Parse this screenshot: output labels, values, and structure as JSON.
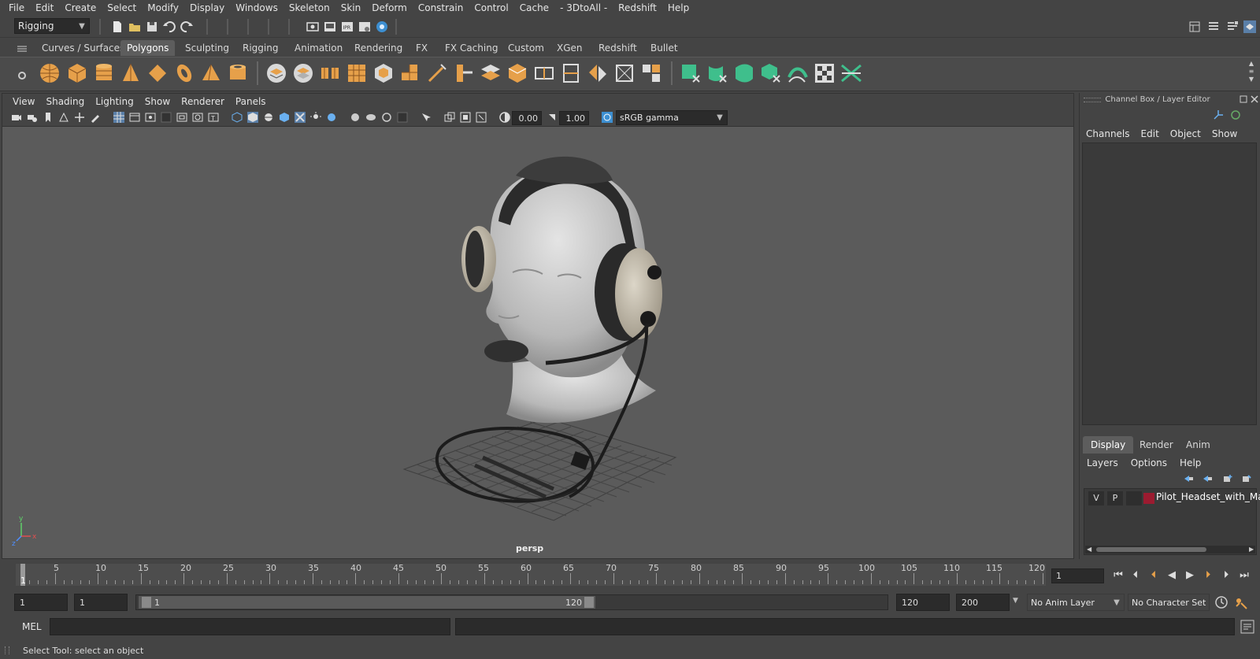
{
  "menubar": {
    "items": [
      "File",
      "Edit",
      "Create",
      "Select",
      "Modify",
      "Display",
      "Windows",
      "Skeleton",
      "Skin",
      "Deform",
      "Constrain",
      "Control",
      "Cache",
      "- 3DtoAll -",
      "Redshift",
      "Help"
    ]
  },
  "statusline": {
    "menuset": "Rigging"
  },
  "shelf": {
    "tabs": [
      "Curves / Surfaces",
      "Polygons",
      "Sculpting",
      "Rigging",
      "Animation",
      "Rendering",
      "FX",
      "FX Caching",
      "Custom",
      "XGen",
      "Redshift",
      "Bullet"
    ],
    "active_tab": "Polygons"
  },
  "viewport": {
    "menus": [
      "View",
      "Shading",
      "Lighting",
      "Show",
      "Renderer",
      "Panels"
    ],
    "exposure": "0.00",
    "gamma": "1.00",
    "colorspace": "sRGB gamma",
    "camera_label": "persp",
    "axis_labels": {
      "y": "y",
      "x": "x",
      "z": "z"
    }
  },
  "channelbox": {
    "title": "Channel Box / Layer Editor",
    "menus": [
      "Channels",
      "Edit",
      "Object",
      "Show"
    ]
  },
  "layereditor": {
    "tabs": [
      "Display",
      "Render",
      "Anim"
    ],
    "active_tab": "Display",
    "menus": [
      "Layers",
      "Options",
      "Help"
    ],
    "layer": {
      "visible": "V",
      "playback": "P",
      "name": "Pilot_Headset_with_Man",
      "color": "#9b1b30"
    }
  },
  "timeline": {
    "labels": [
      "1",
      "5",
      "10",
      "15",
      "20",
      "25",
      "30",
      "35",
      "40",
      "45",
      "50",
      "55",
      "60",
      "65",
      "70",
      "75",
      "80",
      "85",
      "90",
      "95",
      "100",
      "105",
      "110",
      "115",
      "120"
    ],
    "current_frame": "1"
  },
  "range": {
    "start": "1",
    "playback_start": "1",
    "slider_start": "1",
    "slider_end": "120",
    "playback_end": "120",
    "end": "200",
    "anim_layer": "No Anim Layer",
    "character_set": "No Character Set"
  },
  "commandline": {
    "lang": "MEL"
  },
  "helpline": {
    "text": "Select Tool: select an object"
  },
  "colors": {
    "ui_bg": "#444444",
    "viewport_bg": "#5b5b5b",
    "shelf_icon_orange": "#e6a04a",
    "shelf_icon_green": "#3fbf8c",
    "accent_blue": "#3d8fd1"
  }
}
